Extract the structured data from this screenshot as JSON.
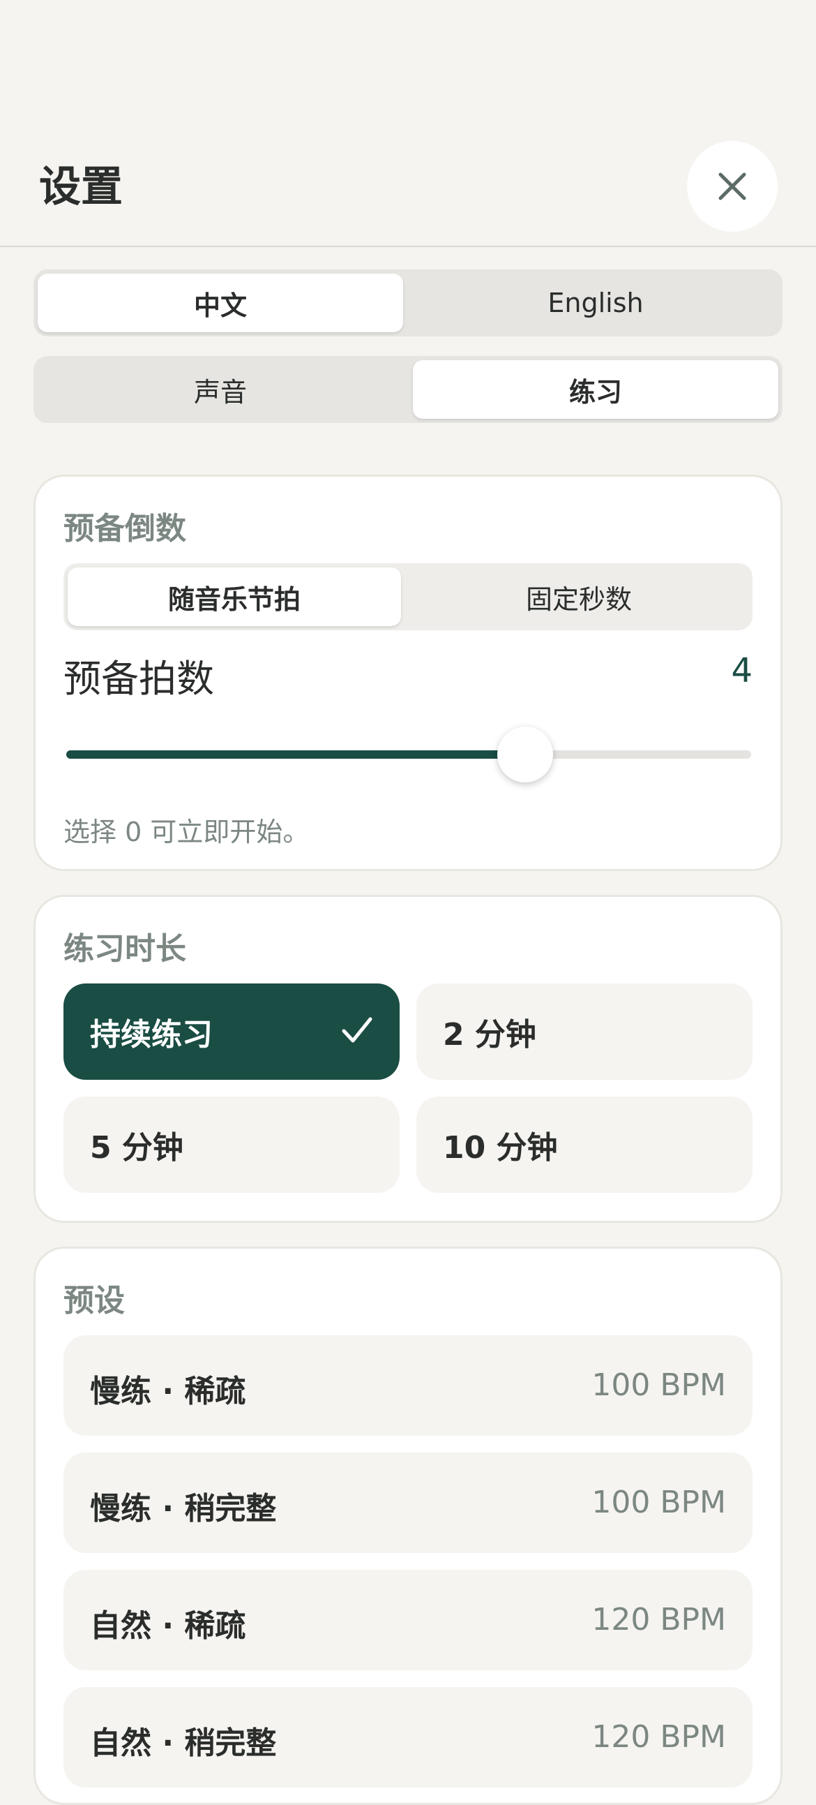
{
  "header": {
    "title": "设置",
    "close_icon": "close-icon"
  },
  "language": {
    "options": [
      "中文",
      "English"
    ],
    "selected": "中文"
  },
  "section_tabs": {
    "options": [
      "声音",
      "练习"
    ],
    "selected": "练习"
  },
  "countdown": {
    "title": "预备倒数",
    "modes": [
      "随音乐节拍",
      "固定秒数"
    ],
    "selected_mode": "随音乐节拍",
    "beats_label": "预备拍数",
    "beats_value": "4",
    "slider_fraction": 0.67,
    "hint": "选择 0 可立即开始。"
  },
  "duration": {
    "title": "练习时长",
    "options": [
      "持续练习",
      "2 分钟",
      "5 分钟",
      "10 分钟"
    ],
    "selected": "持续练习",
    "check_icon": "checkmark-icon"
  },
  "presets": {
    "title": "预设",
    "items": [
      {
        "name": "慢练 · 稀疏",
        "bpm": "100 BPM"
      },
      {
        "name": "慢练 · 稍完整",
        "bpm": "100 BPM"
      },
      {
        "name": "自然 · 稀疏",
        "bpm": "120 BPM"
      },
      {
        "name": "自然 · 稍完整",
        "bpm": "120 BPM"
      }
    ]
  },
  "colors": {
    "background": "#f5f4f0",
    "accent": "#1a4d44",
    "card": "#ffffff",
    "muted_text": "#7c8782"
  }
}
